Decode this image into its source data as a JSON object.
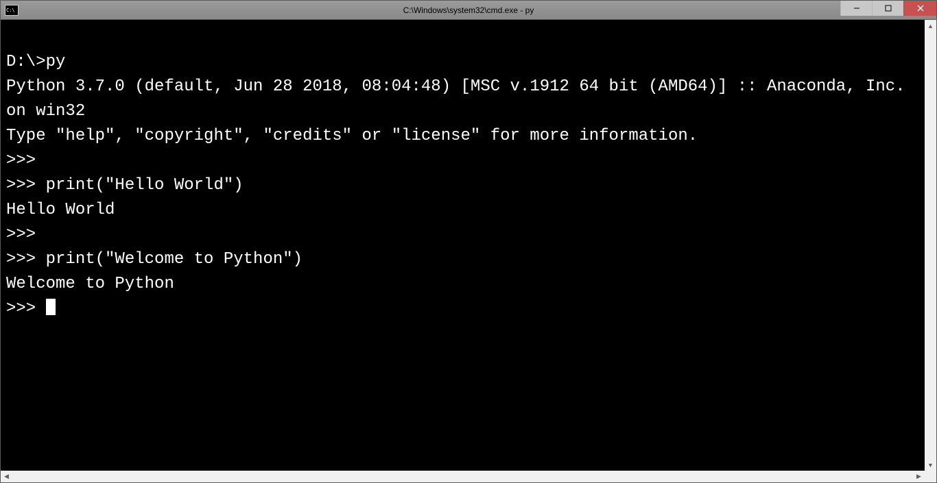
{
  "window": {
    "title": "C:\\Windows\\system32\\cmd.exe - py",
    "icon_label": "C:\\"
  },
  "terminal": {
    "lines": [
      "",
      "D:\\>py",
      "Python 3.7.0 (default, Jun 28 2018, 08:04:48) [MSC v.1912 64 bit (AMD64)] :: Anaconda, Inc. on win32",
      "Type \"help\", \"copyright\", \"credits\" or \"license\" for more information.",
      ">>>",
      ">>> print(\"Hello World\")",
      "Hello World",
      ">>>",
      ">>> print(\"Welcome to Python\")",
      "Welcome to Python",
      ">>> "
    ]
  }
}
